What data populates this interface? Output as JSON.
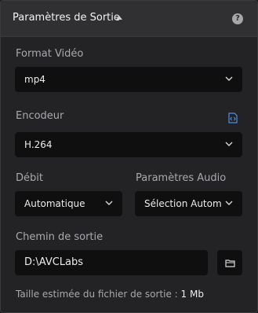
{
  "panel": {
    "title": "Paramètres de Sortie",
    "help_symbol": "?"
  },
  "video_format": {
    "label": "Format Vidéo",
    "value": "mp4"
  },
  "encoder": {
    "label": "Encodeur",
    "value": "H.264"
  },
  "bitrate": {
    "label": "Débit",
    "value": "Automatique"
  },
  "audio": {
    "label": "Paramètres Audio",
    "value": "Sélection Automatique"
  },
  "output_path": {
    "label": "Chemin de sortie",
    "value": "D:\\AVCLabs"
  },
  "estimate": {
    "prefix": "Taille estimée du fichier de sortie : ",
    "value": "1 Mb"
  },
  "colors": {
    "panel_bg": "#232325",
    "header_bg": "#303033",
    "field_bg": "#0f0f10",
    "accent_icon": "#4a8fe0"
  }
}
